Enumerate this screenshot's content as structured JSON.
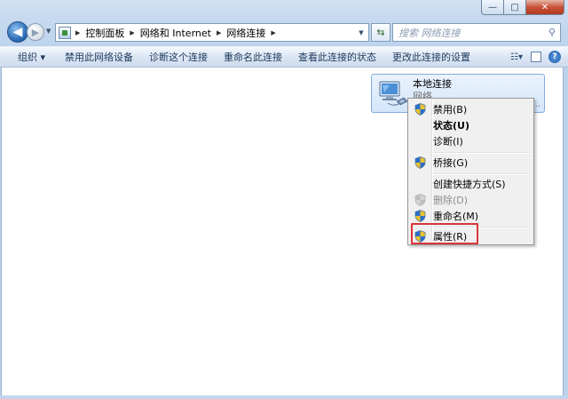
{
  "window": {
    "controls": {
      "minimize": "—",
      "maximize": "□",
      "close": "✕"
    }
  },
  "nav": {
    "back_icon": "back-arrow-icon",
    "forward_icon": "forward-arrow-icon",
    "breadcrumbs": [
      "控制面板",
      "网络和 Internet",
      "网络连接"
    ],
    "search_placeholder": "搜索 网络连接"
  },
  "toolbar": {
    "items": [
      "组织 ▾",
      "禁用此网络设备",
      "诊断这个连接",
      "重命名此连接",
      "查看此连接的状态",
      "更改此连接的设置"
    ]
  },
  "tile": {
    "name": "本地连接",
    "subtitle": "网络",
    "more": "..."
  },
  "context_menu": {
    "items": [
      {
        "label": "禁用(B)",
        "shield": true,
        "bold": false,
        "disabled": false
      },
      {
        "label": "状态(U)",
        "shield": false,
        "bold": true,
        "disabled": false
      },
      {
        "label": "诊断(I)",
        "shield": false,
        "bold": false,
        "disabled": false
      },
      {
        "label": "桥接(G)",
        "shield": true,
        "bold": false,
        "disabled": false
      },
      {
        "label": "创建快捷方式(S)",
        "shield": false,
        "bold": false,
        "disabled": false
      },
      {
        "label": "删除(D)",
        "shield": true,
        "bold": false,
        "disabled": true
      },
      {
        "label": "重命名(M)",
        "shield": true,
        "bold": false,
        "disabled": false
      },
      {
        "label": "属性(R)",
        "shield": true,
        "bold": false,
        "disabled": false
      }
    ]
  },
  "colors": {
    "highlight": "#d9343a",
    "selection_fill": "#d4e6fa",
    "menu_bg": "#f0f0f0"
  }
}
